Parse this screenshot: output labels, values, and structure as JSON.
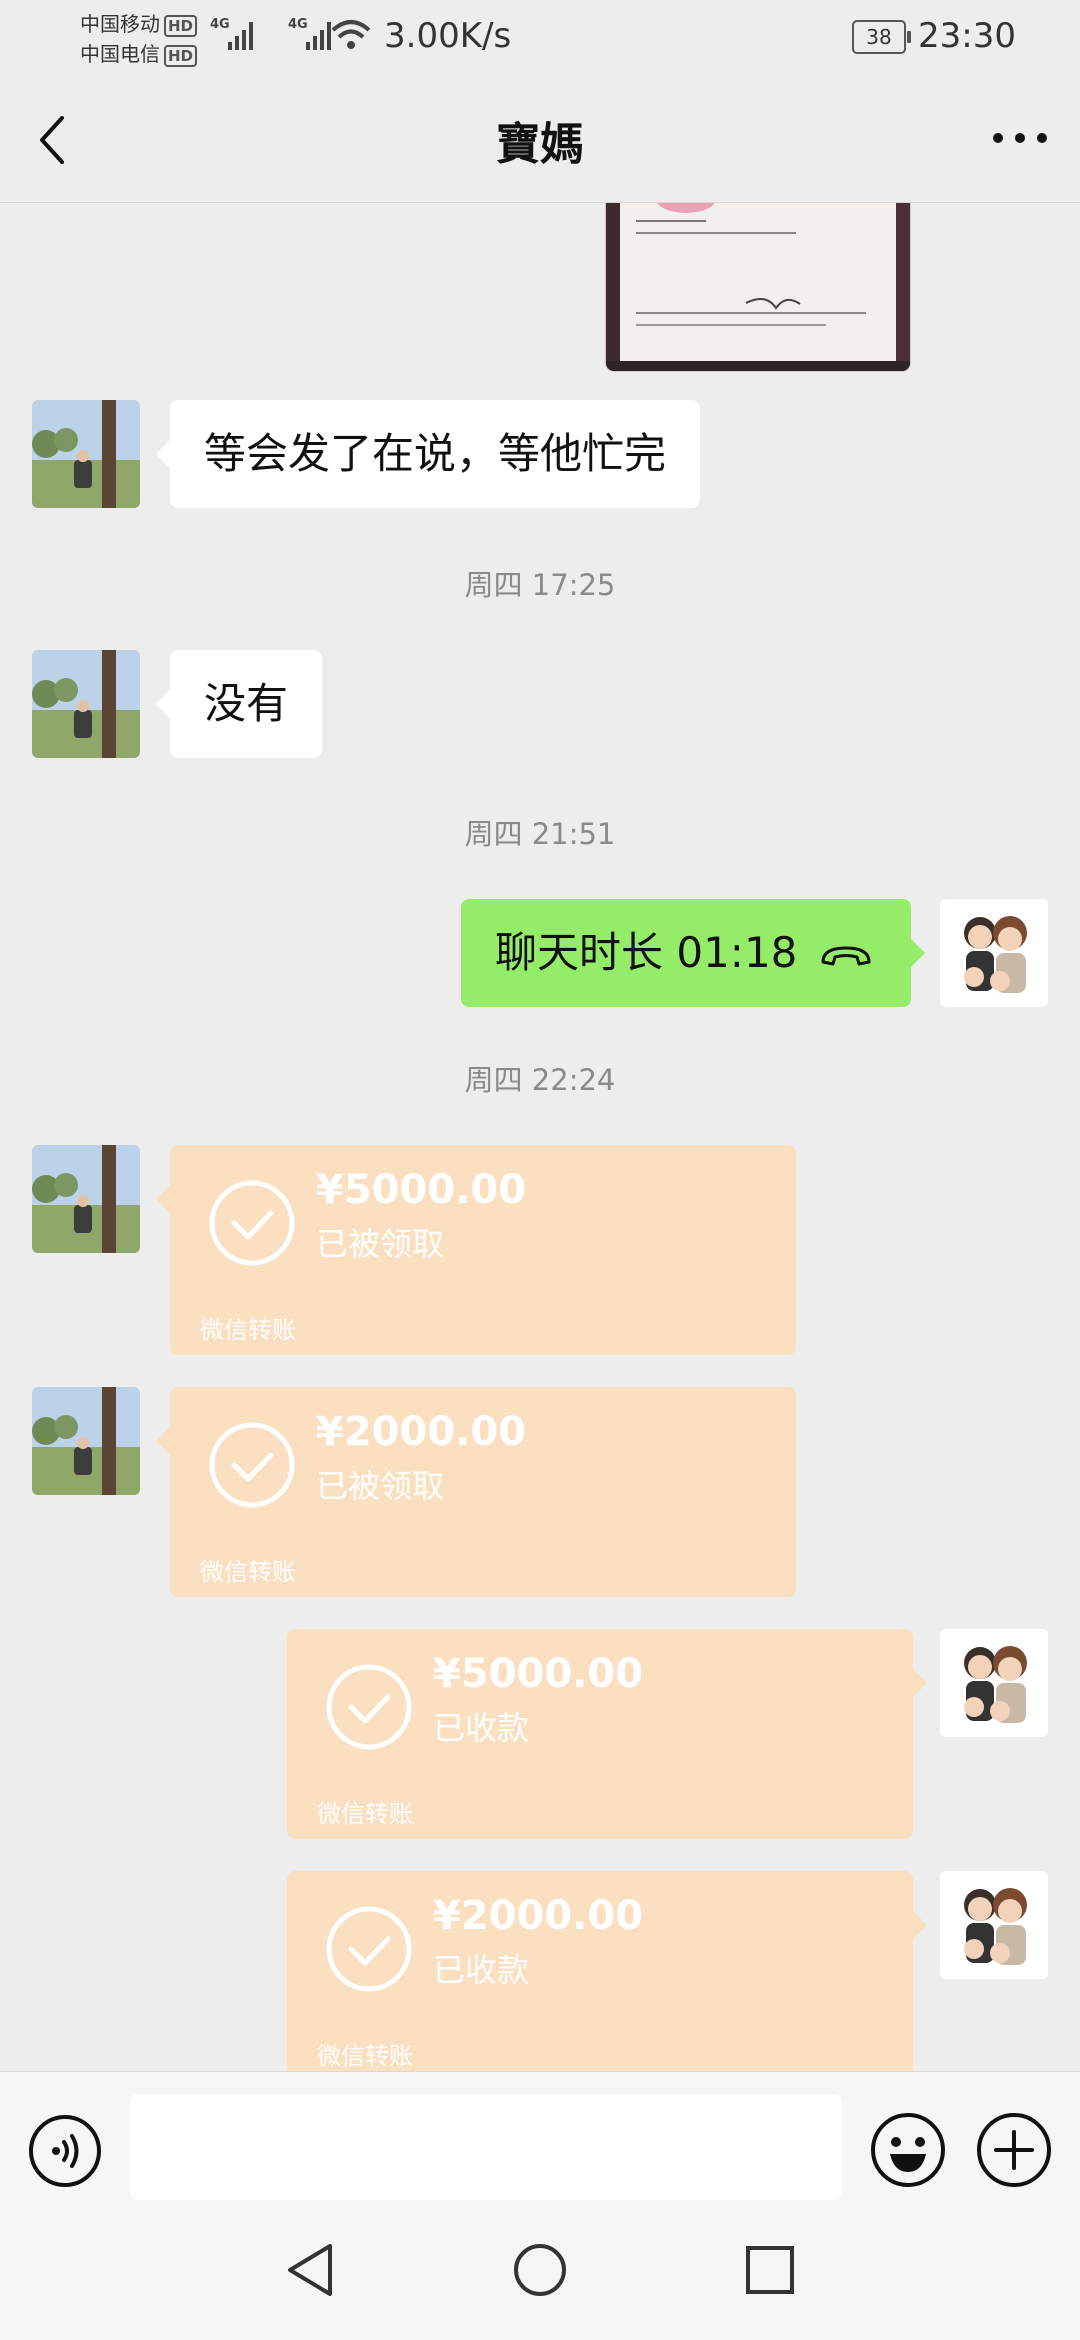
{
  "status_bar": {
    "carrier1": "中国移动",
    "carrier2": "中国电信",
    "hd": "HD",
    "net_type": "4G",
    "speed": "3.00K/s",
    "battery": "38",
    "time": "23:30"
  },
  "header": {
    "title": "寶媽",
    "back_icon": "chevron-left-icon",
    "more_icon": "more-dots-icon"
  },
  "messages": {
    "m1_text": "等会发了在说，等他忙完",
    "sep1": "周四 17:25",
    "m2_text": "没有",
    "sep2": "周四 21:51",
    "m3_text": "聊天时长 01:18",
    "sep3": "周四 22:24",
    "t1": {
      "amount": "¥5000.00",
      "state": "已被领取",
      "label": "微信转账"
    },
    "t2": {
      "amount": "¥2000.00",
      "state": "已被领取",
      "label": "微信转账"
    },
    "t3": {
      "amount": "¥5000.00",
      "state": "已收款",
      "label": "微信转账"
    },
    "t4": {
      "amount": "¥2000.00",
      "state": "已收款",
      "label": "微信转账"
    }
  },
  "colors": {
    "background": "#ededed",
    "sent_bubble": "#95ec69",
    "transfer_bubble": "#fbdfc1"
  },
  "input_bar": {
    "voice_icon": "voice-icon",
    "emoji_icon": "emoji-icon",
    "plus_icon": "plus-icon",
    "text": ""
  },
  "system_nav": {
    "back": "triangle-back-icon",
    "home": "circle-home-icon",
    "recents": "square-recents-icon"
  }
}
